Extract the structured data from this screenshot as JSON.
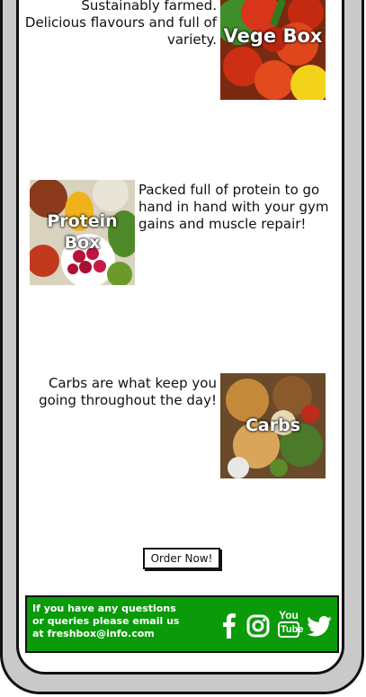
{
  "boxes": [
    {
      "text": "Sustainably farmed. Delicious flavours and full of variety.",
      "label": "Vege Box"
    },
    {
      "text": "Packed full of protein to go hand in hand with your gym gains and muscle repair!",
      "label": "Protein Box"
    },
    {
      "text": "Carbs are what keep you going throughout the day!",
      "label": "Carbs"
    }
  ],
  "order_button": "Order Now!",
  "footer": {
    "contact_text": "If you have any questions or queries please email us at freshbox@info.com",
    "icons": [
      "facebook-icon",
      "instagram-icon",
      "youtube-icon",
      "twitter-icon"
    ],
    "youtube_top": "You",
    "youtube_bottom": "Tube"
  },
  "colors": {
    "footer_bg": "#0a9a0a",
    "frame": "#c9c9c9"
  }
}
